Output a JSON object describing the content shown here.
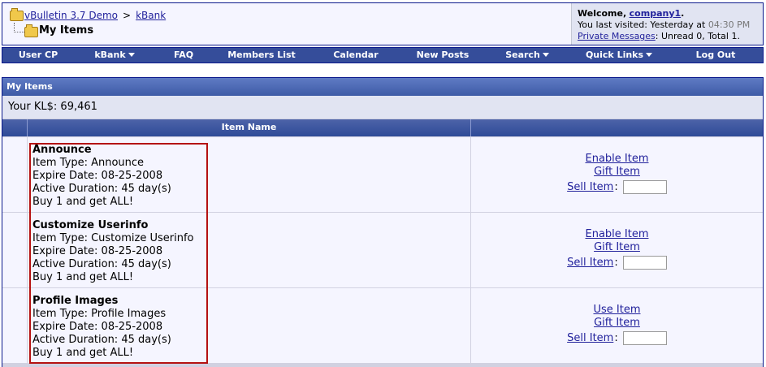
{
  "breadcrumb": {
    "root_label": "vBulletin 3.7 Demo",
    "separator": ">",
    "parent_label": "kBank",
    "current_title": "My Items"
  },
  "welcome": {
    "greeting": "Welcome,",
    "username": "company1",
    "after_name": ".",
    "last_visit_prefix": "You last visited: Yesterday at",
    "last_visit_time": "04:30 PM",
    "pm_link": "Private Messages",
    "pm_status": ": Unread 0, Total 1."
  },
  "navbar": {
    "items": [
      {
        "label": "User CP",
        "dropdown": false
      },
      {
        "label": "kBank",
        "dropdown": true
      },
      {
        "label": "FAQ",
        "dropdown": false
      },
      {
        "label": "Members List",
        "dropdown": false
      },
      {
        "label": "Calendar",
        "dropdown": false
      },
      {
        "label": "New Posts",
        "dropdown": false
      },
      {
        "label": "Search",
        "dropdown": true
      },
      {
        "label": "Quick Links",
        "dropdown": true
      },
      {
        "label": "Log Out",
        "dropdown": false
      }
    ]
  },
  "section": {
    "title": "My Items",
    "balance": "Your KL$: 69,461"
  },
  "table": {
    "col_item_name": "Item Name"
  },
  "items": [
    {
      "name": "Announce",
      "type": "Item Type: Announce",
      "expire": "Expire Date: 08-25-2008",
      "duration": "Active Duration: 45 day(s)",
      "promo": "Buy 1 and get ALL!",
      "action": "Enable Item",
      "gift": "Gift Item",
      "sell": "Sell Item",
      "sell_colon": ":"
    },
    {
      "name": "Customize Userinfo",
      "type": "Item Type: Customize Userinfo",
      "expire": "Expire Date: 08-25-2008",
      "duration": "Active Duration: 45 day(s)",
      "promo": "Buy 1 and get ALL!",
      "action": "Enable Item",
      "gift": "Gift Item",
      "sell": "Sell Item",
      "sell_colon": ":"
    },
    {
      "name": "Profile Images",
      "type": "Item Type: Profile Images",
      "expire": "Expire Date: 08-25-2008",
      "duration": "Active Duration: 45 day(s)",
      "promo": "Buy 1 and get ALL!",
      "action": "Use Item",
      "gift": "Gift Item",
      "sell": "Sell Item",
      "sell_colon": ":"
    }
  ],
  "colors": {
    "nav_bg": "#354d9a",
    "border": "#0b198c",
    "link": "#22229c",
    "highlight_box": "#b51212"
  },
  "icons": {
    "breadcrumb_root": "folder-icon",
    "breadcrumb_current": "folder-open-icon",
    "dropdown": "arrow-down-icon"
  }
}
